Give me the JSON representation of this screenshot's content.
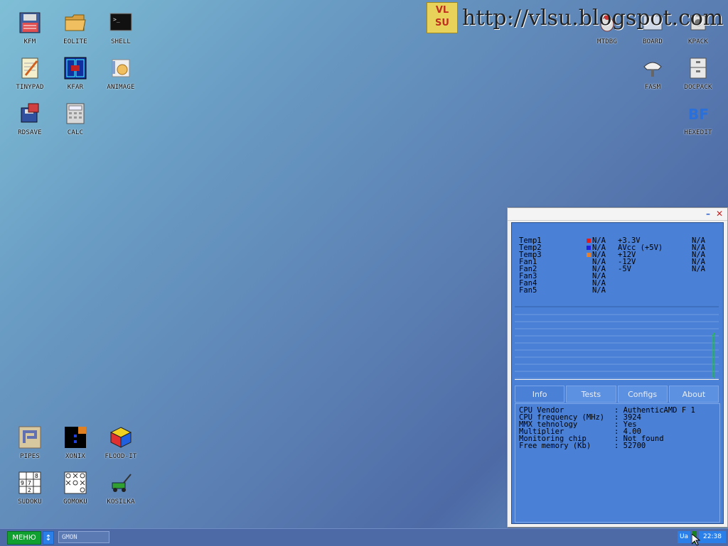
{
  "desktop": {
    "icons_left": [
      {
        "label": "KFM",
        "icon": "floppy-disk-icon"
      },
      {
        "label": "EOLITE",
        "icon": "folder-icon"
      },
      {
        "label": "SHELL",
        "icon": "terminal-icon"
      },
      {
        "label": "TINYPAD",
        "icon": "notepad-icon"
      },
      {
        "label": "KFAR",
        "icon": "far-manager-icon"
      },
      {
        "label": "ANIMAGE",
        "icon": "paint-icon"
      },
      {
        "label": "RDSAVE",
        "icon": "ramdisk-save-icon"
      },
      {
        "label": "CALC",
        "icon": "calculator-icon"
      }
    ],
    "icons_right": [
      {
        "label": "MTDBG",
        "icon": "debugger-icon"
      },
      {
        "label": "BOARD",
        "icon": "board-icon"
      },
      {
        "label": "KPACK",
        "icon": "kpack-icon"
      },
      {
        "label": "FASM",
        "icon": "fasm-icon"
      },
      {
        "label": "DOCPACK",
        "icon": "docpack-icon"
      },
      {
        "label": "HEXEDIT",
        "icon": "hexedit-icon"
      }
    ],
    "icons_games": [
      {
        "label": "PIPES",
        "icon": "pipes-icon"
      },
      {
        "label": "XONIX",
        "icon": "xonix-icon"
      },
      {
        "label": "FLOOD-IT",
        "icon": "rubik-cube-icon"
      },
      {
        "label": "SUDOKU",
        "icon": "sudoku-icon"
      },
      {
        "label": "GOMOKU",
        "icon": "gomoku-icon"
      },
      {
        "label": "KOSILKA",
        "icon": "lawnmower-icon"
      }
    ]
  },
  "watermark": {
    "logo_line1": "VL",
    "logo_line2": "SU",
    "url": "http://vlsu.blogspot.com"
  },
  "gmon": {
    "sensors": [
      {
        "name": "Temp1",
        "value": "N/A",
        "swatch": "#e02020",
        "vname": "+3.3V",
        "vval": "N/A"
      },
      {
        "name": "Temp2",
        "value": "N/A",
        "swatch": "#2020e0",
        "vname": "AVcc (+5V)",
        "vval": "N/A"
      },
      {
        "name": "Temp3",
        "value": "N/A",
        "swatch": "#e08030",
        "vname": "+12V",
        "vval": "N/A"
      },
      {
        "name": "Fan1",
        "value": "N/A",
        "swatch": "",
        "vname": "-12V",
        "vval": "N/A"
      },
      {
        "name": "Fan2",
        "value": "N/A",
        "swatch": "",
        "vname": "-5V",
        "vval": "N/A"
      },
      {
        "name": "Fan3",
        "value": "N/A",
        "swatch": "",
        "vname": "",
        "vval": ""
      },
      {
        "name": "Fan4",
        "value": "N/A",
        "swatch": "",
        "vname": "",
        "vval": ""
      },
      {
        "name": "Fan5",
        "value": "N/A",
        "swatch": "",
        "vname": "",
        "vval": ""
      }
    ],
    "tabs": [
      "Info",
      "Tests",
      "Configs",
      "About"
    ],
    "active_tab": "Info",
    "info": [
      {
        "label": "CPU Vendor",
        "value": ": AuthenticAMD F 1"
      },
      {
        "label": "CPU frequency (MHz)",
        "value": ": 3924"
      },
      {
        "label": "MMX tehnology",
        "value": ": Yes"
      },
      {
        "label": "Multiplier",
        "value": ": 4.00"
      },
      {
        "label": "Monitoring chip",
        "value": ": Not found"
      },
      {
        "label": "Free memory (Kb)",
        "value": ": 52700"
      }
    ]
  },
  "taskbar": {
    "menu_label": "МЕНЮ",
    "switch_label": "↕",
    "task_label": "GMON",
    "lang": "Ua",
    "clock": "22:38"
  }
}
